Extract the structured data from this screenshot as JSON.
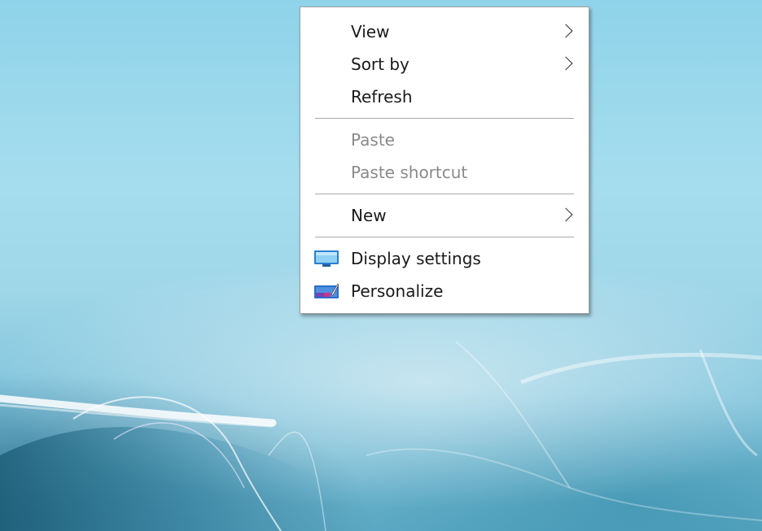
{
  "menu": {
    "items": [
      {
        "label": "View",
        "submenu": true,
        "enabled": true
      },
      {
        "label": "Sort by",
        "submenu": true,
        "enabled": true
      },
      {
        "label": "Refresh",
        "submenu": false,
        "enabled": true
      },
      {
        "label": "Paste",
        "submenu": false,
        "enabled": false
      },
      {
        "label": "Paste shortcut",
        "submenu": false,
        "enabled": false
      },
      {
        "label": "New",
        "submenu": true,
        "enabled": true
      },
      {
        "label": "Display settings",
        "submenu": false,
        "enabled": true,
        "icon": "display-settings-icon"
      },
      {
        "label": "Personalize",
        "submenu": false,
        "enabled": true,
        "icon": "personalize-icon"
      }
    ]
  },
  "colors": {
    "menu_background": "#ffffff",
    "disabled_text": "#8a8a8a",
    "icon_blue": "#2b7fd1"
  }
}
